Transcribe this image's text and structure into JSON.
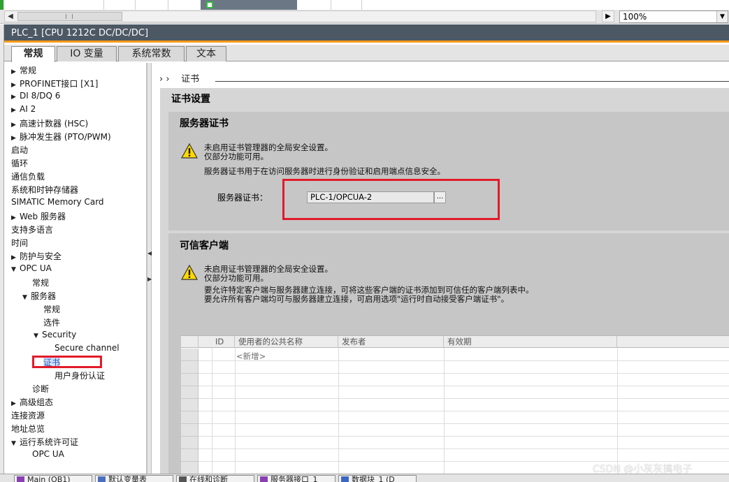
{
  "zoom": {
    "value": "100%"
  },
  "window": {
    "title": "PLC_1 [CPU 1212C DC/DC/DC]"
  },
  "tabs": [
    {
      "label": "常规",
      "active": true
    },
    {
      "label": "IO 变量",
      "active": false
    },
    {
      "label": "系统常数",
      "active": false
    },
    {
      "label": "文本",
      "active": false
    }
  ],
  "nav": {
    "items": [
      {
        "label": "常规",
        "expander": "▶"
      },
      {
        "label": "PROFINET接口 [X1]",
        "expander": "▶"
      },
      {
        "label": "DI 8/DQ 6",
        "expander": "▶"
      },
      {
        "label": "AI 2",
        "expander": "▶"
      },
      {
        "label": "高速计数器 (HSC)",
        "expander": "▶"
      },
      {
        "label": "脉冲发生器 (PTO/PWM)",
        "expander": "▶"
      },
      {
        "label": "启动",
        "expander": ""
      },
      {
        "label": "循环",
        "expander": ""
      },
      {
        "label": "通信负载",
        "expander": ""
      },
      {
        "label": "系统和时钟存储器",
        "expander": ""
      },
      {
        "label": "SIMATIC Memory Card",
        "expander": ""
      },
      {
        "label": "Web 服务器",
        "expander": "▶"
      },
      {
        "label": "支持多语言",
        "expander": ""
      },
      {
        "label": "时间",
        "expander": ""
      },
      {
        "label": "防护与安全",
        "expander": "▶"
      },
      {
        "label": "OPC UA",
        "expander": "▼"
      },
      {
        "label": "常规",
        "expander": ""
      },
      {
        "label": "服务器",
        "expander": "▼"
      },
      {
        "label": "常规",
        "expander": ""
      },
      {
        "label": "选件",
        "expander": ""
      },
      {
        "label": "Security",
        "expander": "▼"
      },
      {
        "label": "Secure channel",
        "expander": ""
      },
      {
        "label": "证书",
        "expander": ""
      },
      {
        "label": "用户身份认证",
        "expander": ""
      },
      {
        "label": "诊断",
        "expander": ""
      },
      {
        "label": "高级组态",
        "expander": "▶"
      },
      {
        "label": "连接资源",
        "expander": ""
      },
      {
        "label": "地址总览",
        "expander": ""
      },
      {
        "label": "运行系统许可证",
        "expander": "▼"
      },
      {
        "label": "OPC UA",
        "expander": ""
      }
    ]
  },
  "breadcrumb": {
    "arrows": "› ›",
    "label": "证书"
  },
  "content": {
    "section_title": "证书设置",
    "server_cert": {
      "title": "服务器证书",
      "warning_line1": "未启用证书管理器的全局安全设置。",
      "warning_line2": "仅部分功能可用。",
      "info": "服务器证书用于在访问服务器时进行身份验证和启用端点信息安全。",
      "field_label": "服务器证书：",
      "field_value": "PLC-1/OPCUA-2",
      "browse_label": "..."
    },
    "trusted_clients": {
      "title": "可信客户端",
      "warning_line1": "未启用证书管理器的全局安全设置。",
      "warning_line2": "仅部分功能可用。",
      "info_line1": "要允许特定客户端与服务器建立连接，可将这些客户端的证书添加到可信任的客户端列表中。",
      "info_line2": "要允许所有客户端均可与服务器建立连接，可启用选项\"运行时自动接受客户端证书\"。",
      "table": {
        "columns": [
          "ID",
          "使用者的公共名称",
          "发布者",
          "有效期"
        ],
        "add_new": "<新增>"
      }
    }
  },
  "taskbar": {
    "items": [
      "Main (OB1)",
      "默认变量表",
      "在线和诊断",
      "服务器接口_1",
      "数据块_1 (D"
    ]
  },
  "watermark": "CSDN @小灰灰搞电子",
  "colors": {
    "title_bar": "#4c5864",
    "accent_orange": "#ff9c1a",
    "highlight_red": "#e21b2a"
  }
}
